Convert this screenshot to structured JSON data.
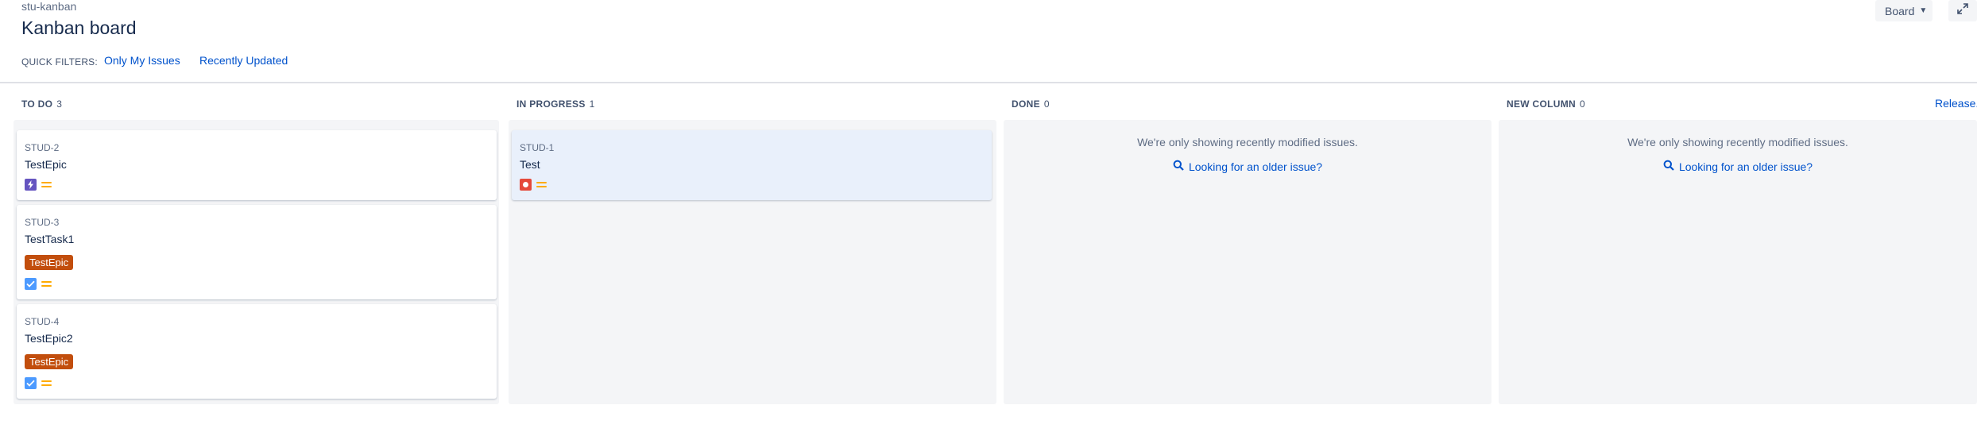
{
  "header": {
    "breadcrumb": "stu-kanban",
    "title": "Kanban board",
    "board_select": "Board",
    "icons": {
      "board_select": "chevron-down-icon",
      "expand": "expand-icon"
    }
  },
  "quick_filters": {
    "label": "QUICK FILTERS:",
    "items": [
      "Only My Issues",
      "Recently Updated"
    ]
  },
  "columns": [
    {
      "name": "TO DO",
      "count": "3",
      "cards": [
        {
          "key": "STUD-2",
          "summary": "TestEpic",
          "epic": "",
          "type_icon": "epic-icon",
          "type_color": "#6554c0",
          "priority_icon": "medium-priority-icon"
        },
        {
          "key": "STUD-3",
          "summary": "TestTask1",
          "epic": "TestEpic",
          "type_icon": "task-icon",
          "type_color": "#4c9aff",
          "priority_icon": "medium-priority-icon"
        },
        {
          "key": "STUD-4",
          "summary": "TestEpic2",
          "epic": "TestEpic",
          "type_icon": "task-icon",
          "type_color": "#4c9aff",
          "priority_icon": "medium-priority-icon"
        }
      ]
    },
    {
      "name": "IN PROGRESS",
      "count": "1",
      "cards": [
        {
          "key": "STUD-1",
          "summary": "Test",
          "epic": "",
          "type_icon": "bug-icon",
          "type_color": "#e5493a",
          "priority_icon": "medium-priority-icon"
        }
      ]
    },
    {
      "name": "DONE",
      "count": "0",
      "empty_message": "We're only showing recently modified issues.",
      "older_link": "Looking for an older issue?"
    },
    {
      "name": "NEW COLUMN",
      "count": "0",
      "empty_message": "We're only showing recently modified issues.",
      "older_link": "Looking for an older issue?"
    }
  ],
  "release_link": "Release...",
  "colors": {
    "link": "#0052cc",
    "epic_label": "#c24e0d",
    "column_bg": "#f4f5f7",
    "selected_card": "#e9f0fb",
    "priority_medium": "#ffab00"
  }
}
